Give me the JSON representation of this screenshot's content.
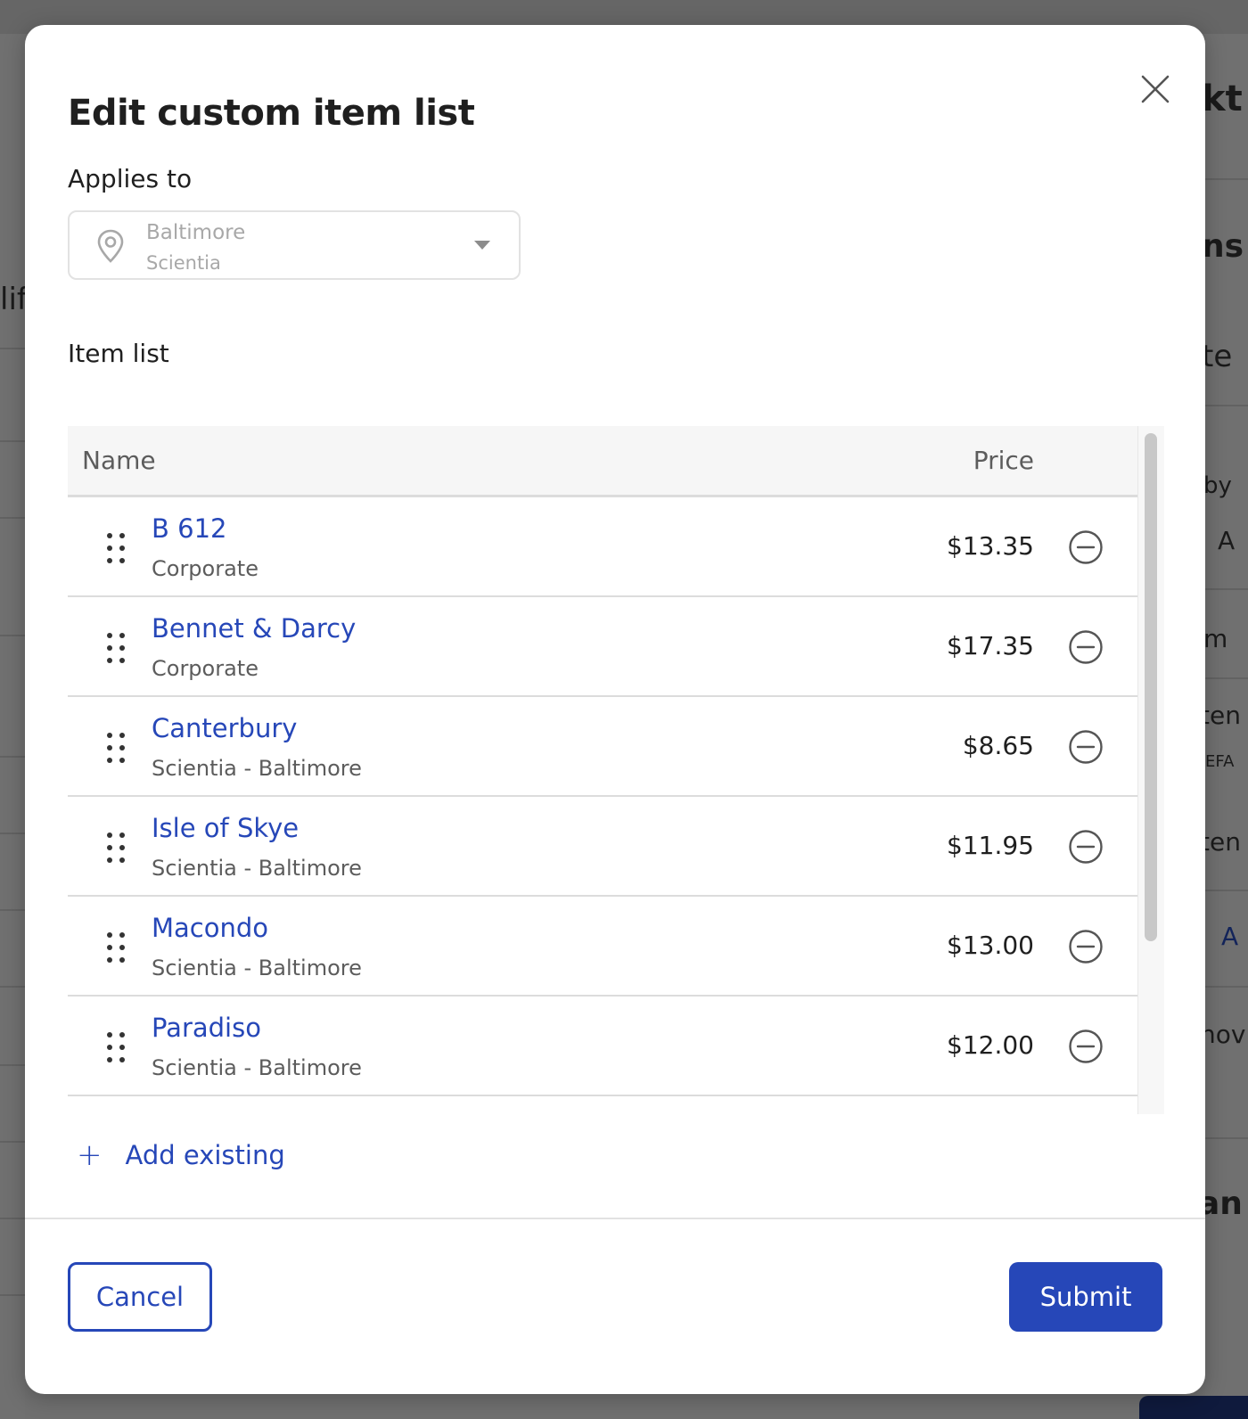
{
  "modal": {
    "title": "Edit custom item list",
    "close_icon": "close-icon"
  },
  "applies_to": {
    "label": "Applies to",
    "location_line1": "Baltimore",
    "location_line2": "Scientia",
    "icon": "location-pin-icon"
  },
  "item_list": {
    "label": "Item list",
    "columns": {
      "name": "Name",
      "price": "Price"
    },
    "rows": [
      {
        "name": "B 612",
        "group": "Corporate",
        "price": "$13.35"
      },
      {
        "name": "Bennet & Darcy",
        "group": "Corporate",
        "price": "$17.35"
      },
      {
        "name": "Canterbury",
        "group": "Scientia - Baltimore",
        "price": "$8.65"
      },
      {
        "name": "Isle of Skye",
        "group": "Scientia - Baltimore",
        "price": "$11.95"
      },
      {
        "name": "Macondo",
        "group": "Scientia - Baltimore",
        "price": "$13.00"
      },
      {
        "name": "Paradiso",
        "group": "Scientia - Baltimore",
        "price": "$12.00"
      }
    ]
  },
  "actions": {
    "add_existing": "Add existing",
    "cancel": "Cancel",
    "submit": "Submit"
  },
  "background": {
    "fragments": [
      "kt",
      "ns",
      "te",
      "by",
      "A",
      "m",
      "ten",
      "EFA",
      "ten",
      "A",
      "hov",
      "an",
      "lif"
    ]
  },
  "colors": {
    "accent": "#2647b8",
    "overlay": "#6f6f6f"
  }
}
